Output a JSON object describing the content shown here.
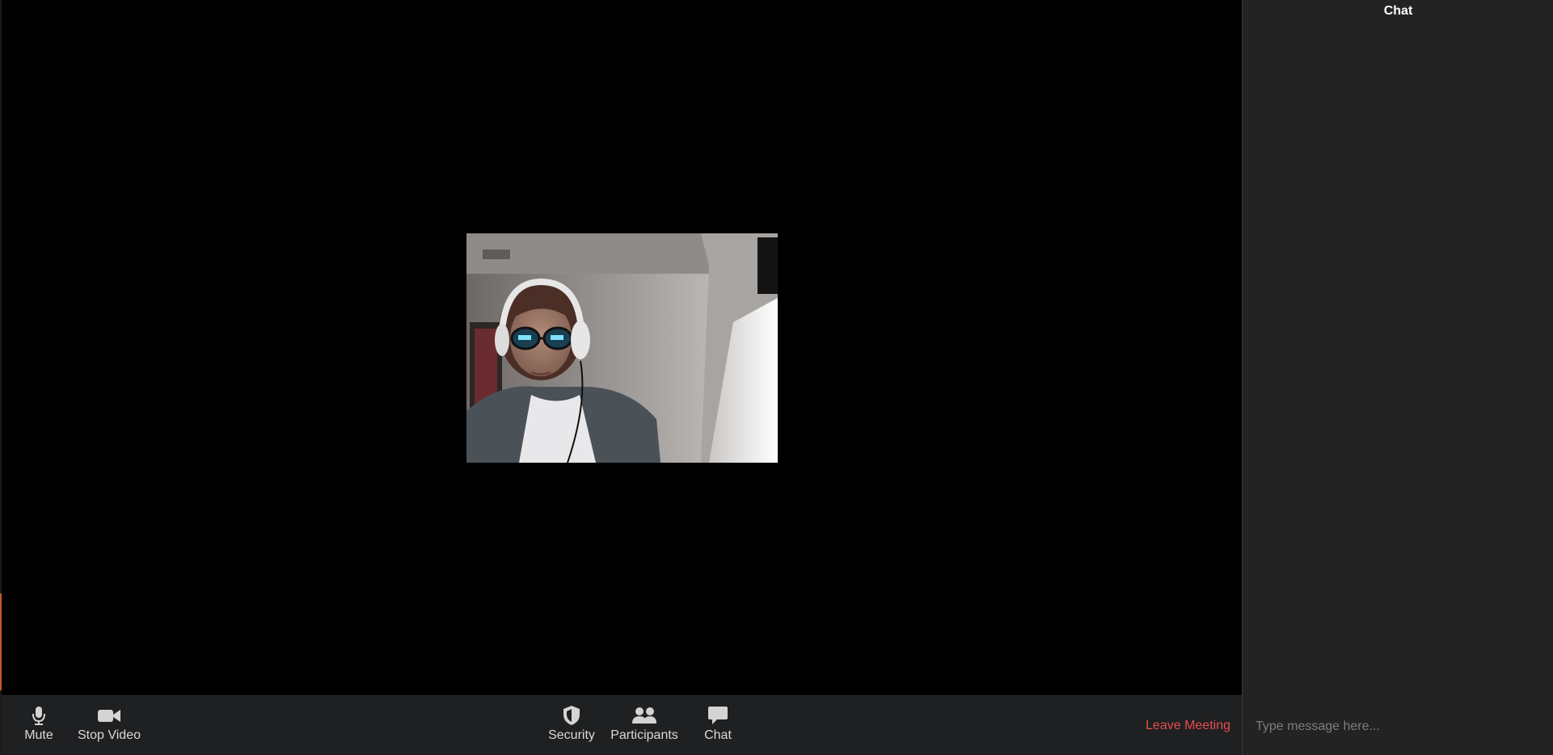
{
  "toolbar": {
    "mute_label": "Mute",
    "stop_video_label": "Stop Video",
    "security_label": "Security",
    "participants_label": "Participants",
    "chat_label": "Chat",
    "leave_label": "Leave Meeting"
  },
  "icons": {
    "mute": "microphone-icon",
    "stop_video": "video-camera-icon",
    "security": "shield-icon",
    "participants": "people-icon",
    "chat": "speech-bubble-icon"
  },
  "chat_panel": {
    "title": "Chat",
    "input_placeholder": "Type message here..."
  },
  "colors": {
    "leave_text": "#e84d4d",
    "toolbar_bg": "#1f2022",
    "chat_bg": "#232323",
    "stage_bg": "#000000"
  }
}
